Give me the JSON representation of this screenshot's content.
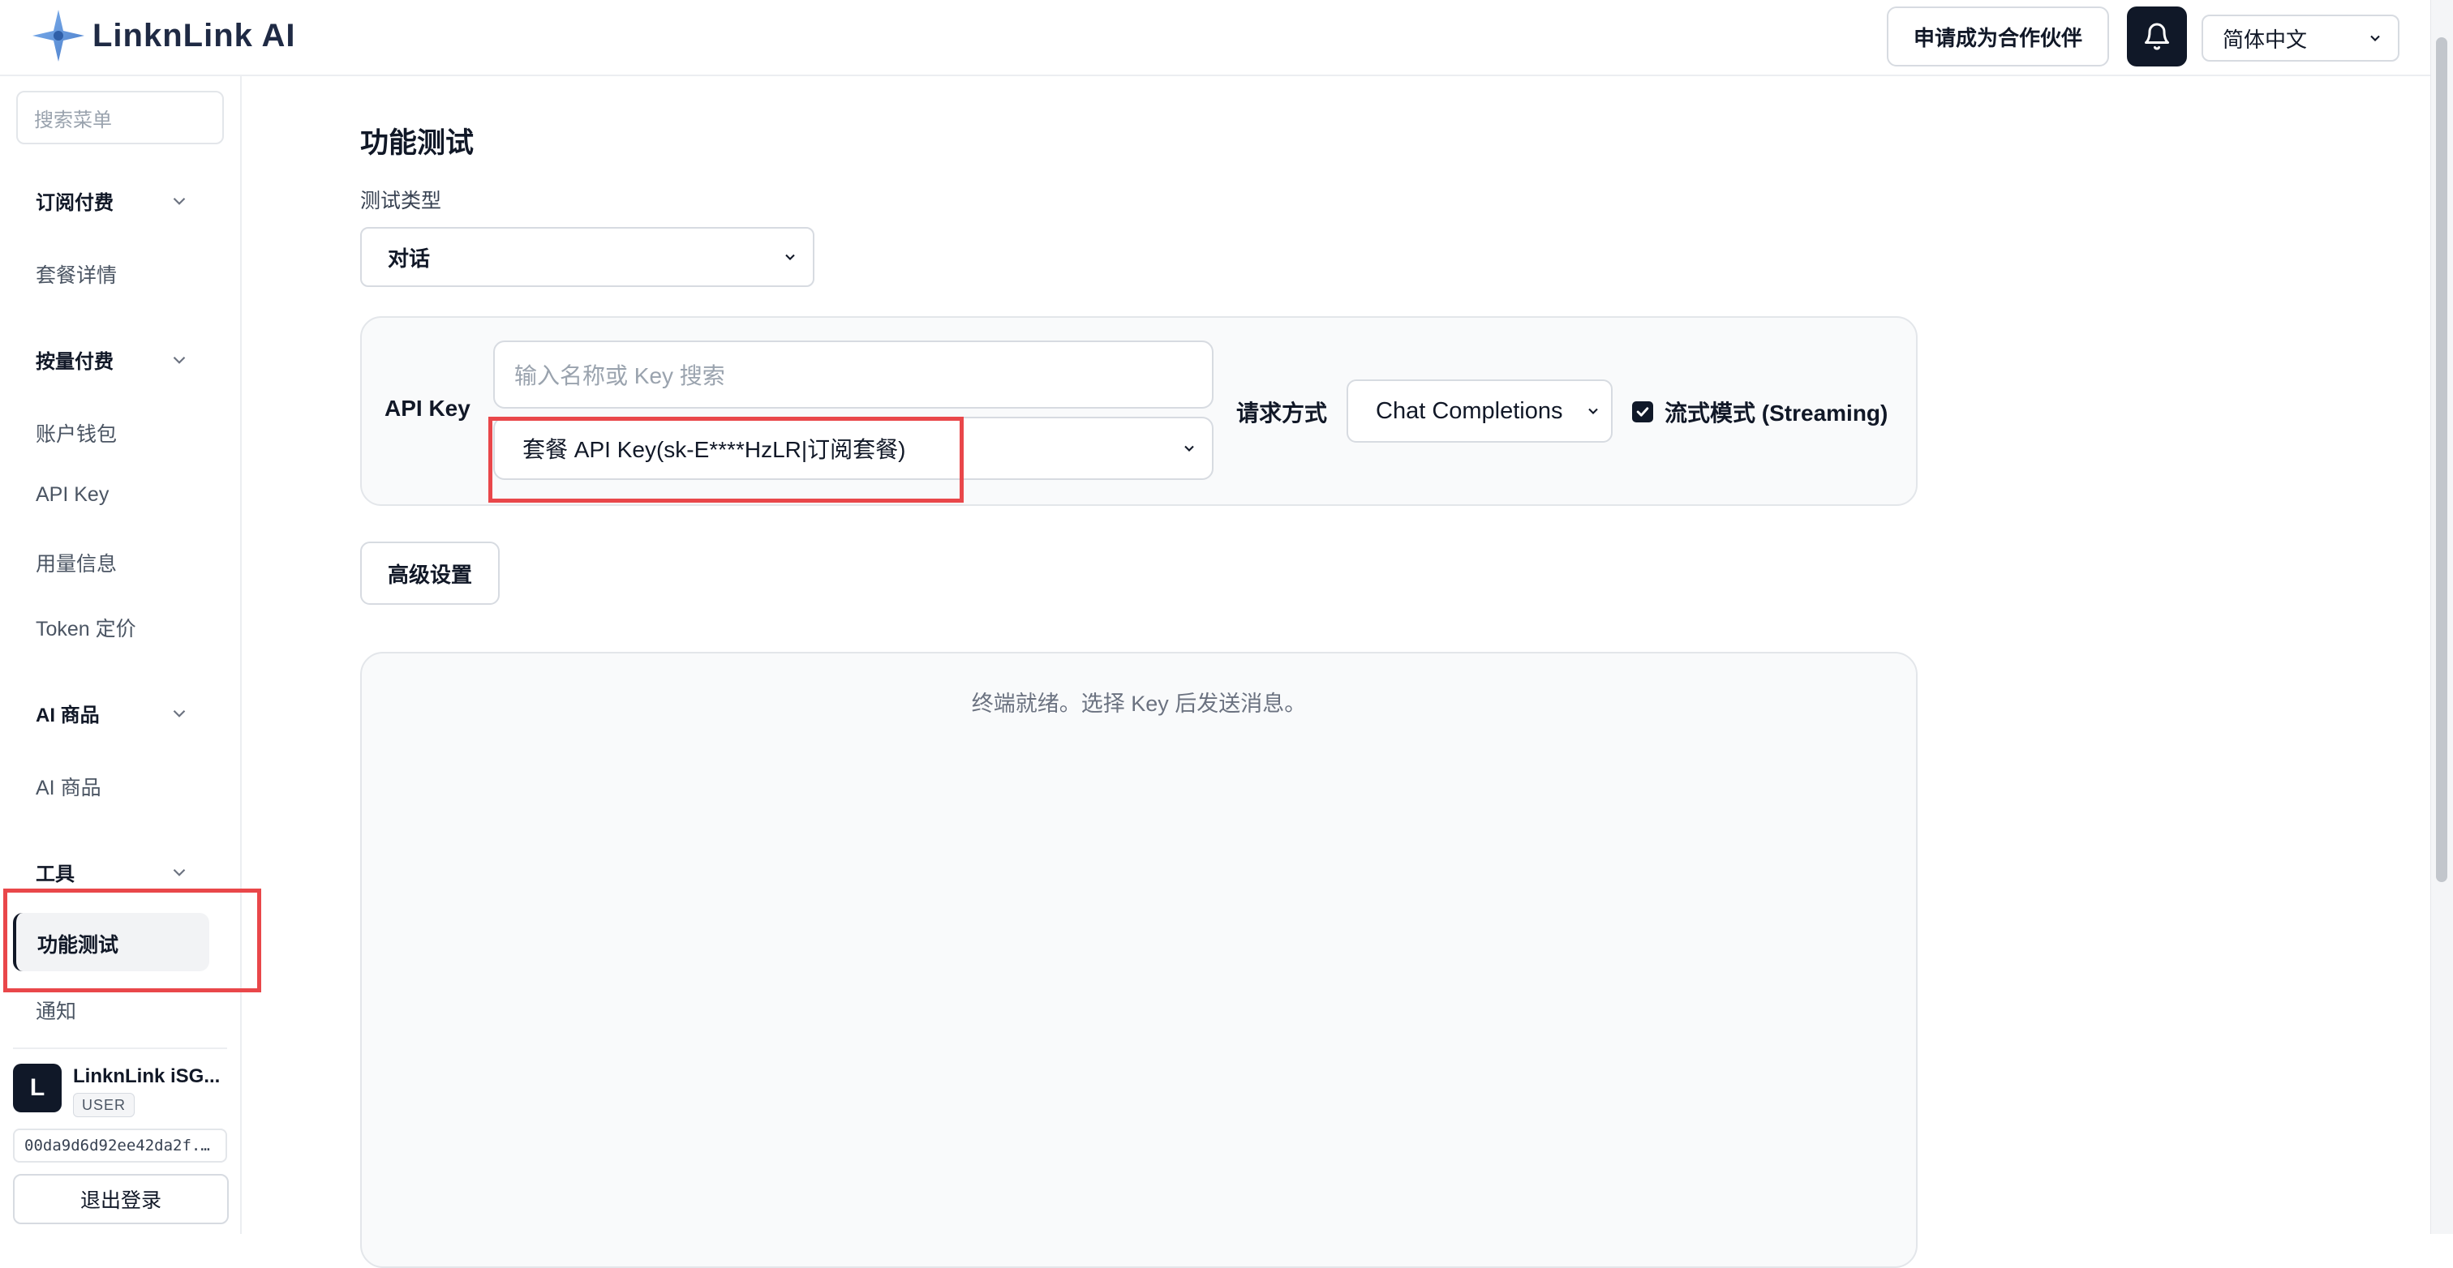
{
  "header": {
    "brand": "LinknLink AI",
    "partner_button": "申请成为合作伙伴",
    "language": "简体中文"
  },
  "sidebar": {
    "search_placeholder": "搜索菜单",
    "groups": [
      {
        "label": "订阅付费",
        "items": [
          "套餐详情"
        ]
      },
      {
        "label": "按量付费",
        "items": [
          "账户钱包",
          "API Key",
          "用量信息",
          "Token 定价"
        ]
      },
      {
        "label": "AI 商品",
        "items": [
          "AI 商品"
        ]
      },
      {
        "label": "工具",
        "items": [
          "功能测试",
          "通知"
        ]
      }
    ],
    "active_item": "功能测试",
    "user": {
      "avatar_letter": "L",
      "name": "LinknLink iSG...",
      "role": "USER",
      "id": "00da9d6d92ee42da2f..."
    },
    "logout": "退出登录"
  },
  "main": {
    "title": "功能测试",
    "test_type_label": "测试类型",
    "test_type_value": "对话",
    "api_key_label": "API Key",
    "key_search_placeholder": "输入名称或 Key 搜索",
    "key_selected": "套餐 API Key(sk-E****HzLR|订阅套餐)",
    "request_method_label": "请求方式",
    "request_method_value": "Chat Completions",
    "streaming_label": "流式模式 (Streaming)",
    "streaming_checked": true,
    "advanced_button": "高级设置",
    "terminal_message": "终端就绪。选择 Key 后发送消息。"
  },
  "colors": {
    "highlight": "#e9474a",
    "dark": "#101828",
    "brand_logo": "#5b8dd6"
  }
}
